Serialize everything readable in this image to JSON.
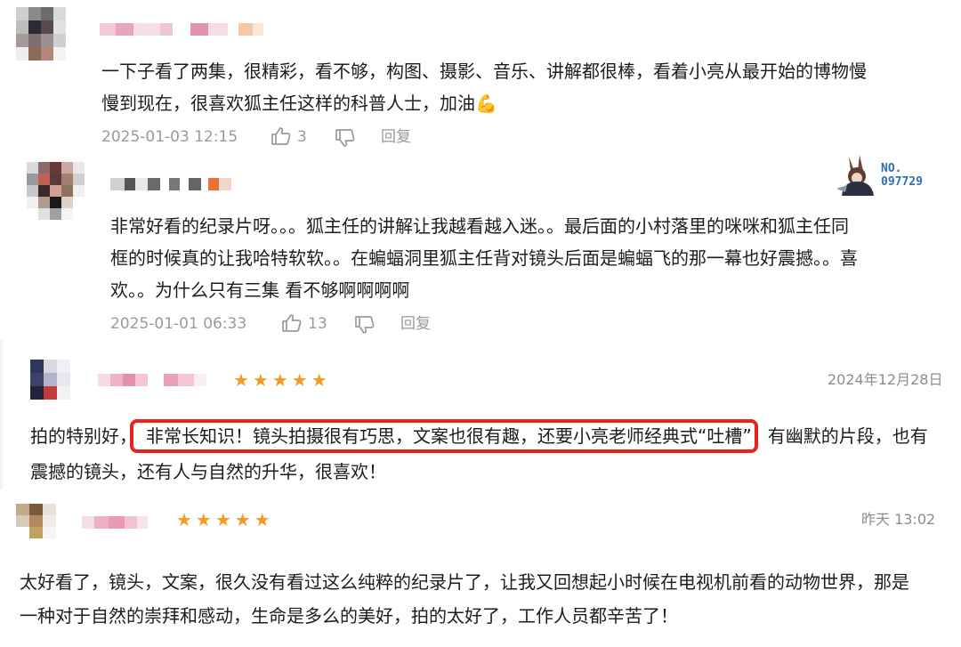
{
  "comments": [
    {
      "text_lines": [
        "一下子看了两集，很精彩，看不够，构图、摄影、音乐、讲解都很棒，看着小亮从最开始的博物慢",
        "慢到现在，很喜欢狐主任这样的科普人士，加油💪"
      ],
      "timestamp": "2025-01-03 12:15",
      "likes": "3",
      "reply_label": "回复"
    },
    {
      "text_lines": [
        "非常好看的纪录片呀。。。狐主任的讲解让我越看越入迷。。最后面的小村落里的咪咪和狐主任同",
        "框的时候真的让我哈特软软。。在蝙蝠洞里狐主任背对镜头后面是蝙蝠飞的那一幕也好震撼。。喜",
        "欢。。为什么只有三集 看不够啊啊啊啊"
      ],
      "timestamp": "2025-01-01 06:33",
      "likes": "13",
      "reply_label": "回复",
      "badge": {
        "line1": "NO.",
        "line2": "097729"
      }
    }
  ],
  "reviews": [
    {
      "stars": "★★★★★",
      "date": "2024年12月28日",
      "line1_before": "拍的特别好，",
      "line1_highlight": "非常长知识！镜头拍摄很有巧思，文案也很有趣，还要小亮老师经典式“吐槽”",
      "line1_after": "有幽默的片段，也有",
      "line2": "震撼的镜头，还有人与自然的升华，很喜欢！"
    },
    {
      "stars": "★★★★★",
      "date": "昨天 13:02",
      "text_lines": [
        "太好看了，镜头，文案，很久没有看过这么纯粹的纪录片了，让我又回想起小时候在电视机前看的动物世界，那是",
        "一种对于自然的崇拜和感动，生命是多么的美好，拍的太好了，工作人员都辛苦了！"
      ]
    }
  ],
  "colors": {
    "star": "#f29b24",
    "highlight_border": "#e8231c",
    "meta_gray": "#9a9a9a"
  }
}
